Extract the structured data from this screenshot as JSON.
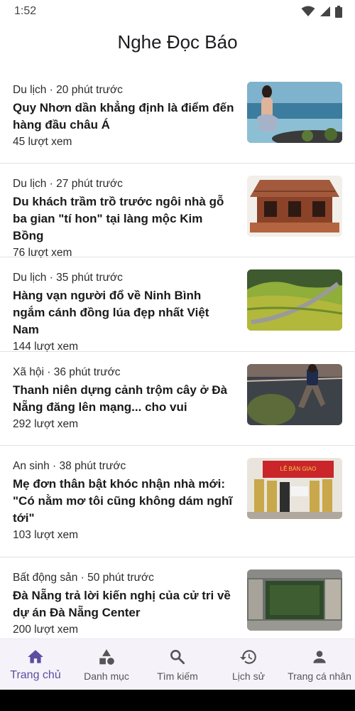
{
  "status": {
    "time": "1:52"
  },
  "app": {
    "title": "Nghe Đọc Báo"
  },
  "articles": [
    {
      "meta": "Du lịch · 20 phút trước",
      "title": "Quy Nhơn dần khẳng định là điểm đến hàng đầu châu Á",
      "views": "45 lượt xem",
      "image": "beach-photo"
    },
    {
      "meta": "Du lịch · 27 phút trước",
      "title": "Du khách trầm trồ trước ngôi nhà gỗ ba gian \"tí hon\" tại làng mộc Kim Bồng",
      "views": "76 lượt xem",
      "image": "wooden-house-photo"
    },
    {
      "meta": "Du lịch · 35 phút trước",
      "title": "Hàng vạn người đổ về Ninh Bình ngắm cánh đồng lúa đẹp nhất Việt Nam",
      "views": "144 lượt xem",
      "image": "rice-field-photo"
    },
    {
      "meta": "Xã hội · 36 phút trước",
      "title": "Thanh niên dựng cảnh trộm cây ở Đà Nẵng đăng lên mạng... cho vui",
      "views": "292 lượt xem",
      "image": "street-night-photo"
    },
    {
      "meta": "An sinh · 38 phút trước",
      "title": "Mẹ đơn thân bật khóc nhận nhà mới: \"Có nằm mơ tôi cũng không dám nghĩ tới\"",
      "views": "103 lượt xem",
      "image": "handover-ceremony-photo"
    },
    {
      "meta": "Bất động sản · 50 phút trước",
      "title": "Đà Nẵng trả lời kiến nghị của cử tri về dự án Đà Nẵng Center",
      "views": "200 lượt xem",
      "image": "aerial-lot-photo"
    }
  ],
  "nav": {
    "items": [
      {
        "label": "Trang chủ",
        "icon": "home-icon",
        "active": true
      },
      {
        "label": "Danh mục",
        "icon": "category-icon",
        "active": false
      },
      {
        "label": "Tìm kiếm",
        "icon": "search-icon",
        "active": false
      },
      {
        "label": "Lịch sử",
        "icon": "history-icon",
        "active": false
      },
      {
        "label": "Trang cá nhân",
        "icon": "person-icon",
        "active": false
      }
    ]
  },
  "colors": {
    "accent": "#5b4fa0",
    "nav_background": "#f6f2fa",
    "text": "#1c1b1f"
  },
  "photo_text": {
    "banner": "LỄ BÀN GIAO"
  }
}
